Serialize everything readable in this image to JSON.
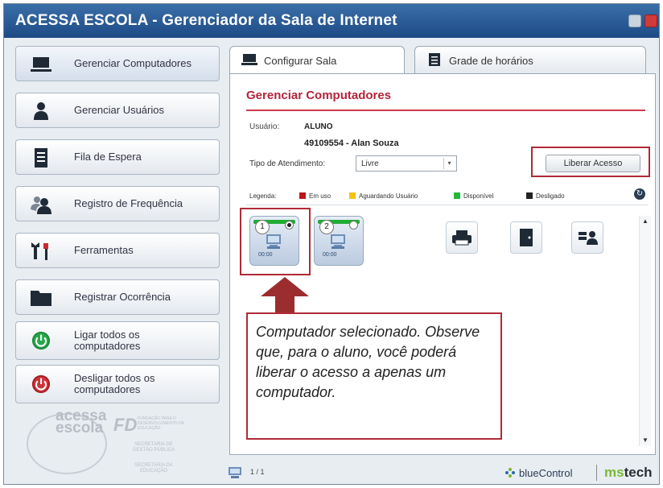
{
  "window": {
    "title": "ACESSA ESCOLA - Gerenciador da Sala de Internet"
  },
  "sidebar": {
    "items": [
      {
        "label": "Gerenciar Computadores",
        "icon": "monitor-icon"
      },
      {
        "label": "Gerenciar Usuários",
        "icon": "user-icon"
      },
      {
        "label": "Fila de Espera",
        "icon": "list-document-icon"
      },
      {
        "label": "Registro de Frequência",
        "icon": "users-group-icon"
      },
      {
        "label": "Ferramentas",
        "icon": "tools-icon"
      },
      {
        "label": "Registrar Ocorrência",
        "icon": "folder-icon"
      },
      {
        "label": "Ligar todos os computadores",
        "icon": "power-on-icon"
      },
      {
        "label": "Desligar todos os computadores",
        "icon": "power-off-icon"
      }
    ]
  },
  "logos": {
    "acessa": "acessa escola",
    "fd": "FD",
    "fd_text": "FUNDAÇÃO PARA O DESENVOLVIMENTO DA EDUCAÇÃO",
    "secretaria_gestao": "SECRETARIA DE GESTÃO PÚBLICA",
    "secretaria_educacao": "SECRETARIA DA EDUCAÇÃO"
  },
  "tabs": [
    {
      "label": "Configurar Sala",
      "icon": "monitor-icon"
    },
    {
      "label": "Grade de horários",
      "icon": "calendar-icon"
    }
  ],
  "panel": {
    "title": "Gerenciar Computadores",
    "user_label": "Usuário:",
    "user_value": "ALUNO",
    "user_name": "49109554 - Alan Souza",
    "tipo_label": "Tipo de Atendimento:",
    "tipo_value": "Livre",
    "liberar_button": "Liberar Acesso",
    "legend": {
      "label": "Legenda:",
      "items": [
        {
          "label": "Em uso",
          "color": "#c0121a"
        },
        {
          "label": "Aguardando Usuário",
          "color": "#f3c316"
        },
        {
          "label": "Disponível",
          "color": "#22b83a"
        },
        {
          "label": "Desligado",
          "color": "#222222"
        }
      ]
    },
    "computers": [
      {
        "number": "1",
        "time": "00:00",
        "selected": true,
        "status_color": "#22b83a"
      },
      {
        "number": "2",
        "time": "00:00",
        "selected": false,
        "status_color": "#22b83a"
      }
    ],
    "tools": [
      "printer-icon",
      "door-icon",
      "users-admin-icon"
    ],
    "callout": "Computador selecionado. Observe que, para o aluno, você poderá liberar o acesso a apenas um computador."
  },
  "footer": {
    "page_count": "1 / 1",
    "brand_bluecontrol": "blueControl",
    "brand_ms": "ms",
    "brand_tech": "tech"
  }
}
